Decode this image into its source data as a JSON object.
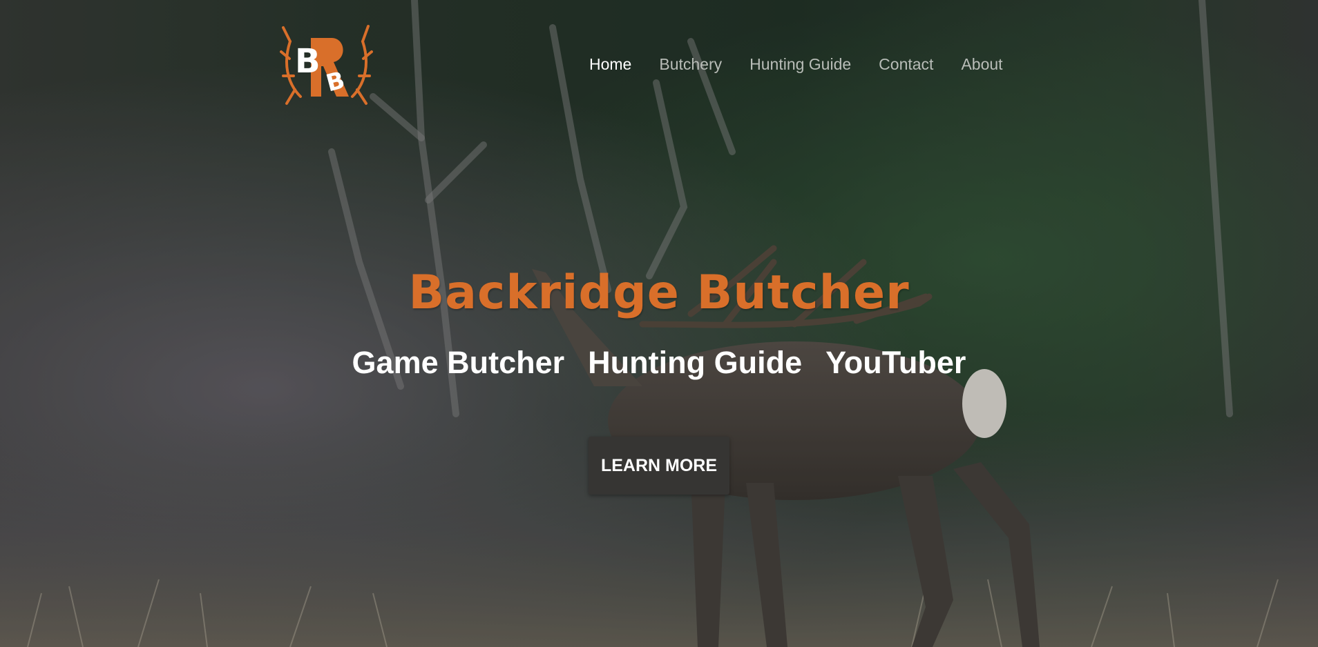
{
  "brand": {
    "logo_letters": [
      "B",
      "R",
      "B"
    ],
    "accent_color": "#d96f2a"
  },
  "nav": {
    "items": [
      {
        "label": "Home",
        "active": true
      },
      {
        "label": "Butchery",
        "active": false
      },
      {
        "label": "Hunting Guide",
        "active": false
      },
      {
        "label": "Contact",
        "active": false
      },
      {
        "label": "About",
        "active": false
      }
    ]
  },
  "hero": {
    "title": "Backridge Butcher",
    "roles": [
      "Game Butcher",
      "Hunting Guide",
      "YouTuber"
    ],
    "cta_label": "LEARN MORE"
  }
}
